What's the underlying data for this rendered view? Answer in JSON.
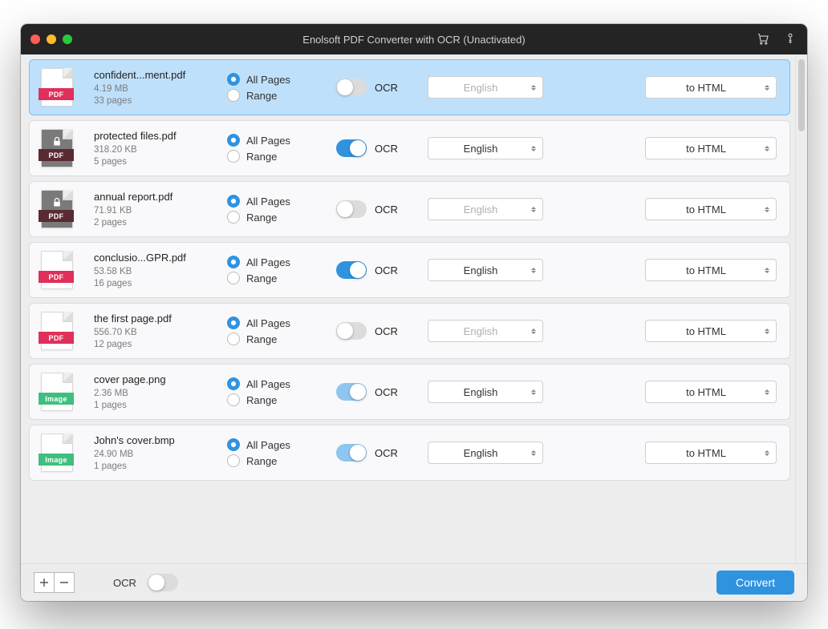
{
  "window": {
    "title": "Enolsoft PDF Converter with OCR (Unactivated)",
    "traffic": {
      "close": "#ff5f57",
      "min": "#febc2e",
      "max": "#28c840"
    }
  },
  "labels": {
    "allPages": "All Pages",
    "range": "Range",
    "ocr": "OCR",
    "convert": "Convert",
    "footerOcr": "OCR"
  },
  "fileTypes": {
    "pdf": {
      "band": "PDF",
      "bg": "#e02f5a",
      "locked": false,
      "page": "#fff"
    },
    "pdf_l": {
      "band": "PDF",
      "bg": "#5a2a33",
      "locked": true,
      "page": "#7a7a7a"
    },
    "img": {
      "band": "Image",
      "bg": "#3fbf7f",
      "locked": false,
      "page": "#fff"
    }
  },
  "files": [
    {
      "name": "confident...ment.pdf",
      "size": "4.19 MB",
      "pages": "33 pages",
      "type": "pdf",
      "ocr": "off",
      "lang": "English",
      "langDis": true,
      "fmt": "to HTML",
      "sel": true
    },
    {
      "name": "protected files.pdf",
      "size": "318.20 KB",
      "pages": "5 pages",
      "type": "pdf_l",
      "ocr": "on",
      "lang": "English",
      "langDis": false,
      "fmt": "to HTML"
    },
    {
      "name": "annual report.pdf",
      "size": "71.91 KB",
      "pages": "2 pages",
      "type": "pdf_l",
      "ocr": "off",
      "lang": "English",
      "langDis": true,
      "fmt": "to HTML"
    },
    {
      "name": "conclusio...GPR.pdf",
      "size": "53.58 KB",
      "pages": "16 pages",
      "type": "pdf",
      "ocr": "on",
      "lang": "English",
      "langDis": false,
      "fmt": "to HTML"
    },
    {
      "name": "the first page.pdf",
      "size": "556.70 KB",
      "pages": "12 pages",
      "type": "pdf",
      "ocr": "off",
      "lang": "English",
      "langDis": true,
      "fmt": "to HTML"
    },
    {
      "name": "cover page.png",
      "size": "2.36 MB",
      "pages": "1 pages",
      "type": "img",
      "ocr": "locked",
      "lang": "English",
      "langDis": false,
      "fmt": "to HTML"
    },
    {
      "name": "John's cover.bmp",
      "size": "24.90 MB",
      "pages": "1 pages",
      "type": "img",
      "ocr": "locked",
      "lang": "English",
      "langDis": false,
      "fmt": "to HTML"
    }
  ],
  "footer": {
    "ocr": "off"
  }
}
